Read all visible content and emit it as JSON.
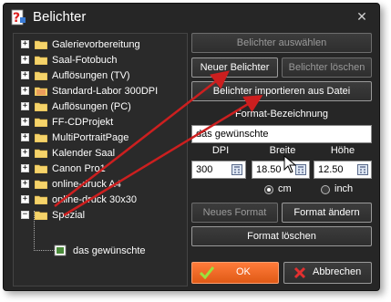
{
  "window": {
    "title": "Belichter",
    "close_symbol": "✕"
  },
  "tree": {
    "items": [
      {
        "label": "Galerievorbereitung",
        "expander": "+"
      },
      {
        "label": "Saal-Fotobuch",
        "expander": "+"
      },
      {
        "label": "Auflösungen (TV)",
        "expander": "+"
      },
      {
        "label": "Standard-Labor 300DPI",
        "expander": "+"
      },
      {
        "label": "Auflösungen (PC)",
        "expander": "+"
      },
      {
        "label": "FF-CDProjekt",
        "expander": "+"
      },
      {
        "label": "MultiPortraitPage",
        "expander": "+"
      },
      {
        "label": "Kalender Saal",
        "expander": "+"
      },
      {
        "label": "Canon Pro1",
        "expander": "+"
      },
      {
        "label": "online-druck A4",
        "expander": "+"
      },
      {
        "label": "online-druck 30x30",
        "expander": "+"
      },
      {
        "label": "Spezial",
        "expander": "−"
      }
    ],
    "child": {
      "label": "das gewünschte"
    }
  },
  "buttons": {
    "select_exposer": "Belichter auswählen",
    "new_exposer": "Neuer Belichter",
    "delete_exposer": "Belichter löschen",
    "import_exposer": "Belichter importieren aus Datei",
    "new_format": "Neues Format",
    "change_format": "Format ändern",
    "delete_format": "Format löschen",
    "ok": "OK",
    "cancel": "Abbrechen"
  },
  "format": {
    "heading": "Format-Bezeichnung",
    "name_value": "das gewünschte",
    "dpi_label": "DPI",
    "width_label": "Breite",
    "height_label": "Höhe",
    "dpi_value": "300",
    "width_value": "18.50",
    "height_value": "12.50",
    "unit_cm": "cm",
    "unit_inch": "inch",
    "selected_unit": "cm"
  },
  "colors": {
    "window_bg": "#262626",
    "ok_accent": "#f26a24",
    "annotation_arrow": "#cc1f1f"
  }
}
